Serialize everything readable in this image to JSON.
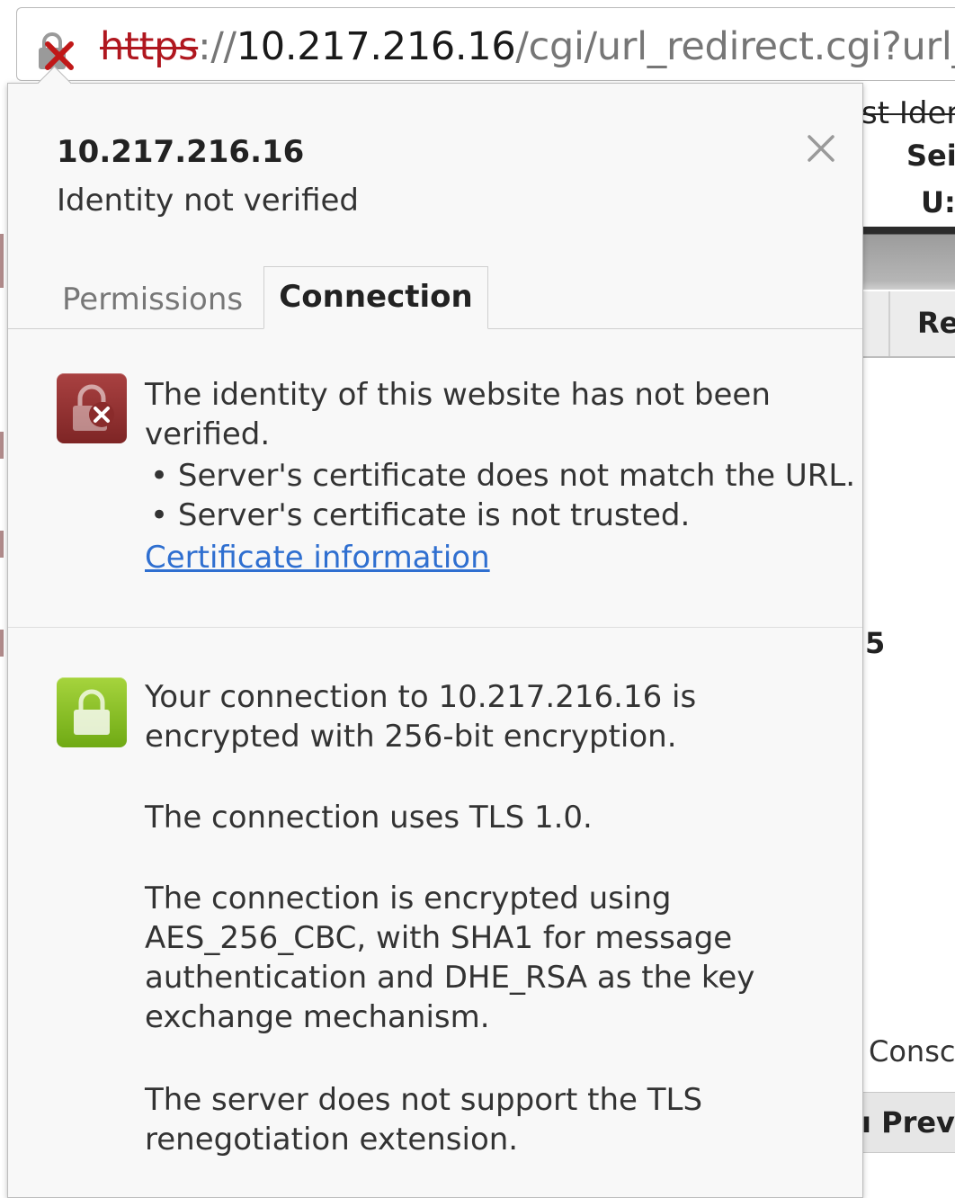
{
  "urlbar": {
    "scheme": "https",
    "separator": "://",
    "host": "10.217.216.16",
    "path": "/cgi/url_redirect.cgi?url_r",
    "security_icon": "broken-lock-red-x-icon"
  },
  "background_page": {
    "title_fragment": "st Ider",
    "row1": "Sei",
    "row2": "U:",
    "header_cell": "Re",
    "number": "5",
    "console_fragment": "Consc",
    "prev_button": "ı Prev"
  },
  "popup": {
    "site": "10.217.216.16",
    "status": "Identity not verified",
    "close_icon": "close-icon",
    "tabs": [
      {
        "label": "Permissions",
        "active": false
      },
      {
        "label": "Connection",
        "active": true
      }
    ],
    "identity": {
      "icon": "broken-lock-icon",
      "message": "The identity of this website has not been verified.",
      "bullets": [
        "• Server's certificate does not match the URL.",
        "• Server's certificate is not trusted."
      ],
      "link": "Certificate information"
    },
    "connection": {
      "icon": "lock-icon",
      "encryption": "Your connection to 10.217.216.16 is encrypted with 256-bit encryption.",
      "protocol": "The connection uses TLS 1.0.",
      "cipher": "The connection is encrypted using AES_256_CBC, with SHA1 for message authentication and DHE_RSA as the key exchange mechanism.",
      "renegotiation": "The server does not support the TLS renegotiation extension."
    }
  },
  "colors": {
    "error_red": "#b0171f",
    "identity_icon_bg": "#8f3030",
    "connection_icon_bg": "#8cc224",
    "link_blue": "#2f6fd0"
  }
}
